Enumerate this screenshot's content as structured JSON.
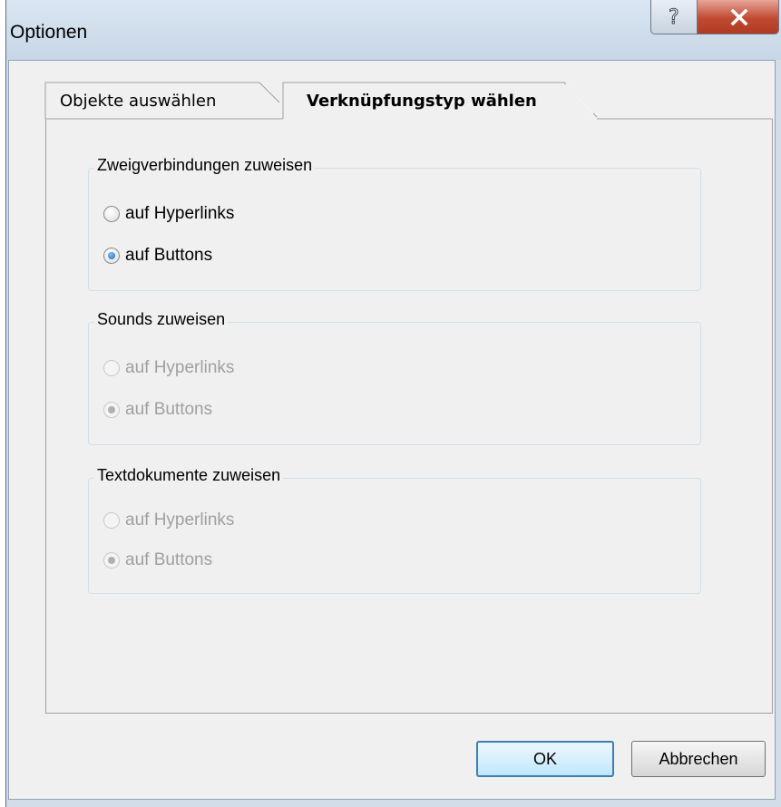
{
  "window": {
    "title": "Optionen",
    "help_glyph": "?",
    "close_glyph": "X"
  },
  "tabs": [
    {
      "label": "Objekte auswählen",
      "selected": false
    },
    {
      "label": "Verknüpfungstyp wählen",
      "selected": true
    }
  ],
  "groups": [
    {
      "label": "Zweigverbindungen zuweisen",
      "enabled": true,
      "options": [
        {
          "label": "auf Hyperlinks",
          "checked": false
        },
        {
          "label": "auf Buttons",
          "checked": true
        }
      ]
    },
    {
      "label": "Sounds zuweisen",
      "enabled": false,
      "options": [
        {
          "label": "auf Hyperlinks",
          "checked": false
        },
        {
          "label": "auf Buttons",
          "checked": true
        }
      ]
    },
    {
      "label": "Textdokumente zuweisen",
      "enabled": false,
      "options": [
        {
          "label": "auf Hyperlinks",
          "checked": false
        },
        {
          "label": "auf Buttons",
          "checked": true
        }
      ]
    }
  ],
  "buttons": {
    "ok": "OK",
    "cancel": "Abbrechen"
  }
}
